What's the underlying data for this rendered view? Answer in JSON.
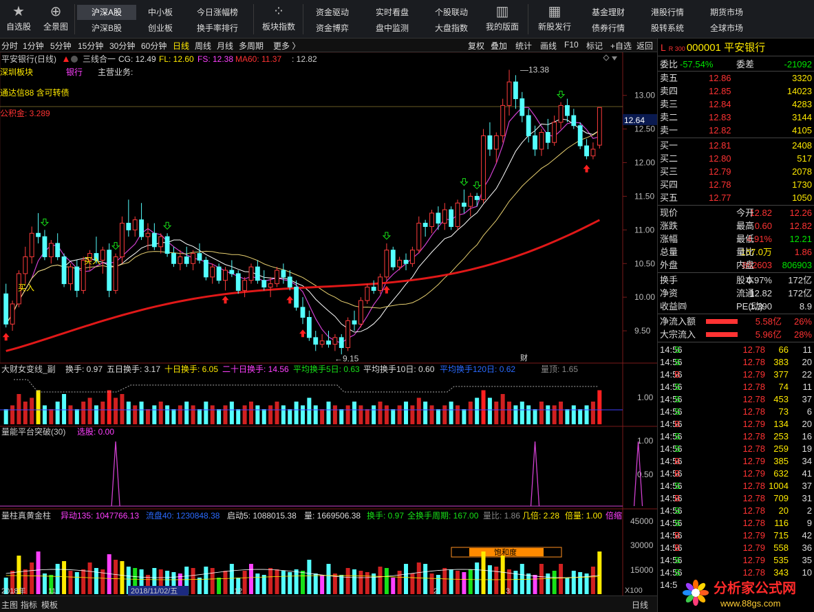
{
  "topbar": {
    "icons": [
      {
        "label": "自选股",
        "icon": "star-icon",
        "glyph": "★"
      },
      {
        "label": "全景图",
        "icon": "globe-icon",
        "glyph": "⊕"
      }
    ],
    "col1": [
      "沪深A股",
      "沪深B股"
    ],
    "col2": [
      "中小板",
      "创业板"
    ],
    "col3": [
      "今日涨幅榜",
      "换手率排行"
    ],
    "icon2": {
      "label": "板块指数",
      "icon": "grid-icon",
      "glyph": "⁘"
    },
    "col4": [
      "资金驱动",
      "资金博弈"
    ],
    "col5": [
      "实时看盘",
      "盘中监测"
    ],
    "col6": [
      "个股联动",
      "大盘指数"
    ],
    "icon3": {
      "label": "我的版面",
      "icon": "layout-icon",
      "glyph": "▥"
    },
    "icon4": {
      "label": "新股发行",
      "icon": "calendar-icon",
      "glyph": "▦"
    },
    "col7": [
      "基金理财",
      "债券行情"
    ],
    "col8": [
      "港股行情",
      "股转系统"
    ],
    "col9": [
      "期货市场",
      "全球市场"
    ]
  },
  "periods": [
    "分时",
    "1分钟",
    "5分钟",
    "15分钟",
    "30分钟",
    "60分钟",
    "日线",
    "周线",
    "月线",
    "多周期",
    "更多 〉"
  ],
  "active_period": "日线",
  "tools": [
    "复权",
    "叠加",
    "统计",
    "画线",
    "F10",
    "标记",
    "+自选",
    "返回"
  ],
  "chart_header": {
    "name": "平安银行(日线)",
    "indicator": "三线合一",
    "cg": "CG: 12.49",
    "fl": "FL: 12.60",
    "fs": "FS: 12.38",
    "ma60": "MA60: 11.37",
    "last": ": 12.82"
  },
  "info_lines": {
    "sector": "深圳板块",
    "industry": "银行",
    "business": "主营业务:",
    "note": "通达信88 含可转债",
    "fund": "公积金: 3.289"
  },
  "annotations": {
    "high": "13.38",
    "low": "9.15",
    "buy1": "买入",
    "buy2": "买入",
    "cai": "财",
    "price_tag": "12.64"
  },
  "price_axis": [
    "13.00",
    "12.50",
    "12.00",
    "11.50",
    "11.00",
    "10.50",
    "10.00",
    "9.50"
  ],
  "panel1": {
    "title": "大财女变线_副",
    "items": [
      "换手: 0.97",
      "五日换手: 3.17",
      "十日换手: 6.05",
      "二十日换手: 14.56",
      "平均换手5日: 0.63",
      "平均换手10日: 0.60",
      "平均换手120日: 0.62",
      "量顶: 1.65"
    ],
    "axis": "1.00"
  },
  "panel2": {
    "title": "量能平台突破(30)",
    "item": "选股: 0.00",
    "axis": [
      "1.00",
      "0.50"
    ]
  },
  "panel3": {
    "title": "量柱真黄金柱",
    "items": [
      "异动135: 1047766.13",
      "流盘40: 1230848.38",
      "启动5: 1088015.38",
      "量: 1669506.38",
      "换手: 0.97",
      "全换手周期: 167.00",
      "量比: 1.86",
      "几倍: 2.28",
      "倍量: 1.00",
      "倍缩"
    ],
    "axis": [
      "45000",
      "30000",
      "15000"
    ],
    "unit": "X100",
    "sat": "饱和度"
  },
  "time_labels": [
    "2018年",
    "11",
    "2018/11/02/五",
    "12",
    "2",
    "3"
  ],
  "bottombar": [
    "主图",
    "指标",
    "模板",
    "日线"
  ],
  "sidebar": {
    "code": "000001",
    "name": "平安银行",
    "market": "R 300",
    "weibi": "-57.54%",
    "weicha": "-21092",
    "asks": [
      {
        "l": "卖五",
        "p": "12.86",
        "v": "3320"
      },
      {
        "l": "卖四",
        "p": "12.85",
        "v": "14023"
      },
      {
        "l": "卖三",
        "p": "12.84",
        "v": "4283"
      },
      {
        "l": "卖二",
        "p": "12.83",
        "v": "3144"
      },
      {
        "l": "卖一",
        "p": "12.82",
        "v": "4105"
      }
    ],
    "bids": [
      {
        "l": "买一",
        "p": "12.81",
        "v": "2408"
      },
      {
        "l": "买二",
        "p": "12.80",
        "v": "517"
      },
      {
        "l": "买三",
        "p": "12.79",
        "v": "2078"
      },
      {
        "l": "买四",
        "p": "12.78",
        "v": "1730"
      },
      {
        "l": "买五",
        "p": "12.77",
        "v": "1050"
      }
    ],
    "quote": [
      [
        "现价",
        "12.82",
        "今开",
        "12.26"
      ],
      [
        "涨跌",
        "0.60",
        "最高",
        "12.82"
      ],
      [
        "涨幅",
        "4.91%",
        "最低",
        "12.21"
      ],
      [
        "总量",
        "167.0万",
        "量比",
        "1.86"
      ],
      [
        "外盘",
        "862603",
        "内盘",
        "806903"
      ]
    ],
    "stats": [
      [
        "换手",
        "0.97%",
        "股本",
        "172亿"
      ],
      [
        "净资",
        "12.82",
        "流通",
        "172亿"
      ],
      [
        "收益㈣",
        "1.390",
        "PE(动)",
        "8.9"
      ]
    ],
    "flows": [
      {
        "l": "净流入额",
        "v": "5.58亿",
        "p": "26%"
      },
      {
        "l": "大宗流入",
        "v": "5.96亿",
        "p": "28%"
      }
    ],
    "ticks": [
      [
        "14:56",
        "12.78",
        "66",
        "S",
        "11"
      ],
      [
        "14:56",
        "12.78",
        "383",
        "S",
        "20"
      ],
      [
        "14:56",
        "12.79",
        "377",
        "B",
        "22"
      ],
      [
        "14:56",
        "12.78",
        "74",
        "S",
        "11"
      ],
      [
        "14:56",
        "12.78",
        "453",
        "S",
        "37"
      ],
      [
        "14:56",
        "12.78",
        "73",
        "S",
        "6"
      ],
      [
        "14:56",
        "12.79",
        "134",
        "B",
        "20"
      ],
      [
        "14:56",
        "12.78",
        "253",
        "S",
        "16"
      ],
      [
        "14:56",
        "12.78",
        "259",
        "S",
        "19"
      ],
      [
        "14:56",
        "12.79",
        "385",
        "B",
        "34"
      ],
      [
        "14:56",
        "12.79",
        "632",
        "B",
        "41"
      ],
      [
        "14:56",
        "12.78",
        "1004",
        "S",
        "37"
      ],
      [
        "14:56",
        "12.78",
        "709",
        "B",
        "31"
      ],
      [
        "14:56",
        "12.78",
        "20",
        "S",
        "2"
      ],
      [
        "14:56",
        "12.78",
        "116",
        "S",
        "9"
      ],
      [
        "14:56",
        "12.79",
        "715",
        "B",
        "42"
      ],
      [
        "14:56",
        "12.79",
        "558",
        "B",
        "36"
      ],
      [
        "14:56",
        "12.79",
        "535",
        "S",
        "35"
      ],
      [
        "14:56",
        "12.78",
        "343",
        "S",
        "10"
      ]
    ],
    "footer_time": "14:5"
  },
  "watermark": {
    "cn": "分析家公式网",
    "url": "www.88gs.com"
  },
  "chart_data": {
    "type": "candlestick",
    "ohlc": [
      [
        10.05,
        10.2,
        9.55,
        9.6
      ],
      [
        9.6,
        9.95,
        9.5,
        9.9
      ],
      [
        9.9,
        10.4,
        9.85,
        10.35
      ],
      [
        10.35,
        10.75,
        10.2,
        10.6
      ],
      [
        10.6,
        11.05,
        10.5,
        10.95
      ],
      [
        10.95,
        11.25,
        10.8,
        10.9
      ],
      [
        10.9,
        11.0,
        10.55,
        10.6
      ],
      [
        10.6,
        10.85,
        10.5,
        10.8
      ],
      [
        10.8,
        10.95,
        10.55,
        10.6
      ],
      [
        10.6,
        10.65,
        10.15,
        10.2
      ],
      [
        10.2,
        10.5,
        10.1,
        10.45
      ],
      [
        10.45,
        10.55,
        10.0,
        10.1
      ],
      [
        10.1,
        10.6,
        10.05,
        10.55
      ],
      [
        10.55,
        10.7,
        10.4,
        10.65
      ],
      [
        10.65,
        10.9,
        10.5,
        10.55
      ],
      [
        10.55,
        10.75,
        10.35,
        10.7
      ],
      [
        10.7,
        10.8,
        10.0,
        10.1
      ],
      [
        10.1,
        10.65,
        10.05,
        10.6
      ],
      [
        10.6,
        11.2,
        10.5,
        11.1
      ],
      [
        11.1,
        11.45,
        10.9,
        11.0
      ],
      [
        11.0,
        11.2,
        10.9,
        11.15
      ],
      [
        11.15,
        11.4,
        10.85,
        10.9
      ],
      [
        10.9,
        11.1,
        10.7,
        10.95
      ],
      [
        10.95,
        11.1,
        10.7,
        10.75
      ],
      [
        10.75,
        10.95,
        10.65,
        10.9
      ],
      [
        10.9,
        10.95,
        10.6,
        10.65
      ],
      [
        10.65,
        10.75,
        10.45,
        10.5
      ],
      [
        10.5,
        10.7,
        10.4,
        10.6
      ],
      [
        10.6,
        10.75,
        10.45,
        10.5
      ],
      [
        10.5,
        10.7,
        10.4,
        10.65
      ],
      [
        10.65,
        10.8,
        10.5,
        10.55
      ],
      [
        10.55,
        10.6,
        10.25,
        10.3
      ],
      [
        10.3,
        10.5,
        10.2,
        10.45
      ],
      [
        10.45,
        10.5,
        10.2,
        10.25
      ],
      [
        10.25,
        10.45,
        10.1,
        10.4
      ],
      [
        10.4,
        10.55,
        10.3,
        10.35
      ],
      [
        10.35,
        10.4,
        10.05,
        10.1
      ],
      [
        10.1,
        10.3,
        10.0,
        10.25
      ],
      [
        10.25,
        10.5,
        10.2,
        10.45
      ],
      [
        10.45,
        10.55,
        10.2,
        10.25
      ],
      [
        10.25,
        10.4,
        10.1,
        10.15
      ],
      [
        10.15,
        10.3,
        10.0,
        10.2
      ],
      [
        10.2,
        10.45,
        10.15,
        10.4
      ],
      [
        10.4,
        10.5,
        10.2,
        10.3
      ],
      [
        10.3,
        10.4,
        10.1,
        10.15
      ],
      [
        10.15,
        10.25,
        9.8,
        9.85
      ],
      [
        9.85,
        10.0,
        9.6,
        9.7
      ],
      [
        9.7,
        9.8,
        9.35,
        9.4
      ],
      [
        9.4,
        9.5,
        9.2,
        9.3
      ],
      [
        9.3,
        9.45,
        9.25,
        9.35
      ],
      [
        9.35,
        9.5,
        9.25,
        9.3
      ],
      [
        9.3,
        9.45,
        9.2,
        9.4
      ],
      [
        9.4,
        9.45,
        9.15,
        9.25
      ],
      [
        9.25,
        9.7,
        9.2,
        9.65
      ],
      [
        9.65,
        9.8,
        9.5,
        9.6
      ],
      [
        9.6,
        10.0,
        9.55,
        9.95
      ],
      [
        9.95,
        10.2,
        9.9,
        10.15
      ],
      [
        10.15,
        10.25,
        10.05,
        10.1
      ],
      [
        10.1,
        10.35,
        10.05,
        10.3
      ],
      [
        10.3,
        10.8,
        10.25,
        10.7
      ],
      [
        10.7,
        10.75,
        10.4,
        10.45
      ],
      [
        10.45,
        10.6,
        10.4,
        10.55
      ],
      [
        10.55,
        10.65,
        10.4,
        10.5
      ],
      [
        10.5,
        10.75,
        10.45,
        10.7
      ],
      [
        10.7,
        11.2,
        10.65,
        11.1
      ],
      [
        11.1,
        11.15,
        10.9,
        11.05
      ],
      [
        11.05,
        11.3,
        10.95,
        11.25
      ],
      [
        11.25,
        11.35,
        11.0,
        11.1
      ],
      [
        11.1,
        11.4,
        11.0,
        11.3
      ],
      [
        11.3,
        11.35,
        11.0,
        11.05
      ],
      [
        11.05,
        11.45,
        11.0,
        11.4
      ],
      [
        11.4,
        11.6,
        11.25,
        11.35
      ],
      [
        11.35,
        11.55,
        11.2,
        11.5
      ],
      [
        11.5,
        11.55,
        11.35,
        11.45
      ],
      [
        11.45,
        12.5,
        11.4,
        12.4
      ],
      [
        12.4,
        12.6,
        12.1,
        12.2
      ],
      [
        12.2,
        12.45,
        12.0,
        12.4
      ],
      [
        12.4,
        12.95,
        12.3,
        12.85
      ],
      [
        12.85,
        13.38,
        12.7,
        13.2
      ],
      [
        13.2,
        13.3,
        12.8,
        12.95
      ],
      [
        12.95,
        13.05,
        12.6,
        12.7
      ],
      [
        12.7,
        12.8,
        12.3,
        12.4
      ],
      [
        12.4,
        12.55,
        12.1,
        12.2
      ],
      [
        12.2,
        12.5,
        12.1,
        12.45
      ],
      [
        12.45,
        12.65,
        12.2,
        12.3
      ],
      [
        12.3,
        12.7,
        12.25,
        12.6
      ],
      [
        12.6,
        12.9,
        12.5,
        12.85
      ],
      [
        12.85,
        12.95,
        12.6,
        12.7
      ],
      [
        12.7,
        12.8,
        12.5,
        12.55
      ],
      [
        12.55,
        12.6,
        12.2,
        12.25
      ],
      [
        12.25,
        12.35,
        12.05,
        12.1
      ],
      [
        12.1,
        12.3,
        12.05,
        12.2
      ],
      [
        12.26,
        12.82,
        12.21,
        12.82
      ]
    ],
    "ylim": [
      9.0,
      13.6
    ],
    "ma60_range": [
      9.2,
      11.37
    ],
    "volume_ratio": [
      0.4,
      0.5,
      0.8,
      0.6,
      0.7,
      0.9,
      0.5,
      0.4,
      0.6,
      0.8,
      0.5,
      0.4,
      0.6,
      0.7,
      0.5,
      0.6,
      0.9,
      0.7,
      0.8,
      0.6,
      0.5,
      0.6,
      0.4,
      0.5,
      0.6,
      0.5,
      0.4,
      0.5,
      0.6,
      0.5,
      0.4,
      0.6,
      0.5,
      0.4,
      0.5,
      0.6,
      0.4,
      0.5,
      0.6,
      0.5,
      0.4,
      0.5,
      0.6,
      0.5,
      0.4,
      0.6,
      0.5,
      0.7,
      0.5,
      0.4,
      0.6,
      0.5,
      0.4,
      0.5,
      0.6,
      0.5,
      0.4,
      0.5,
      0.6,
      0.5,
      0.4,
      0.5,
      0.6,
      0.5,
      0.7,
      0.6,
      0.5,
      0.4,
      0.5,
      0.6,
      0.5,
      0.4,
      0.6,
      0.7,
      0.9,
      0.7,
      0.6,
      0.8,
      0.6,
      0.5,
      0.6,
      0.5,
      0.4,
      0.6,
      0.5,
      0.5,
      0.6,
      0.4,
      0.5,
      0.4,
      0.5,
      0.6,
      0.9
    ],
    "pulses": [
      17,
      82,
      98
    ]
  }
}
